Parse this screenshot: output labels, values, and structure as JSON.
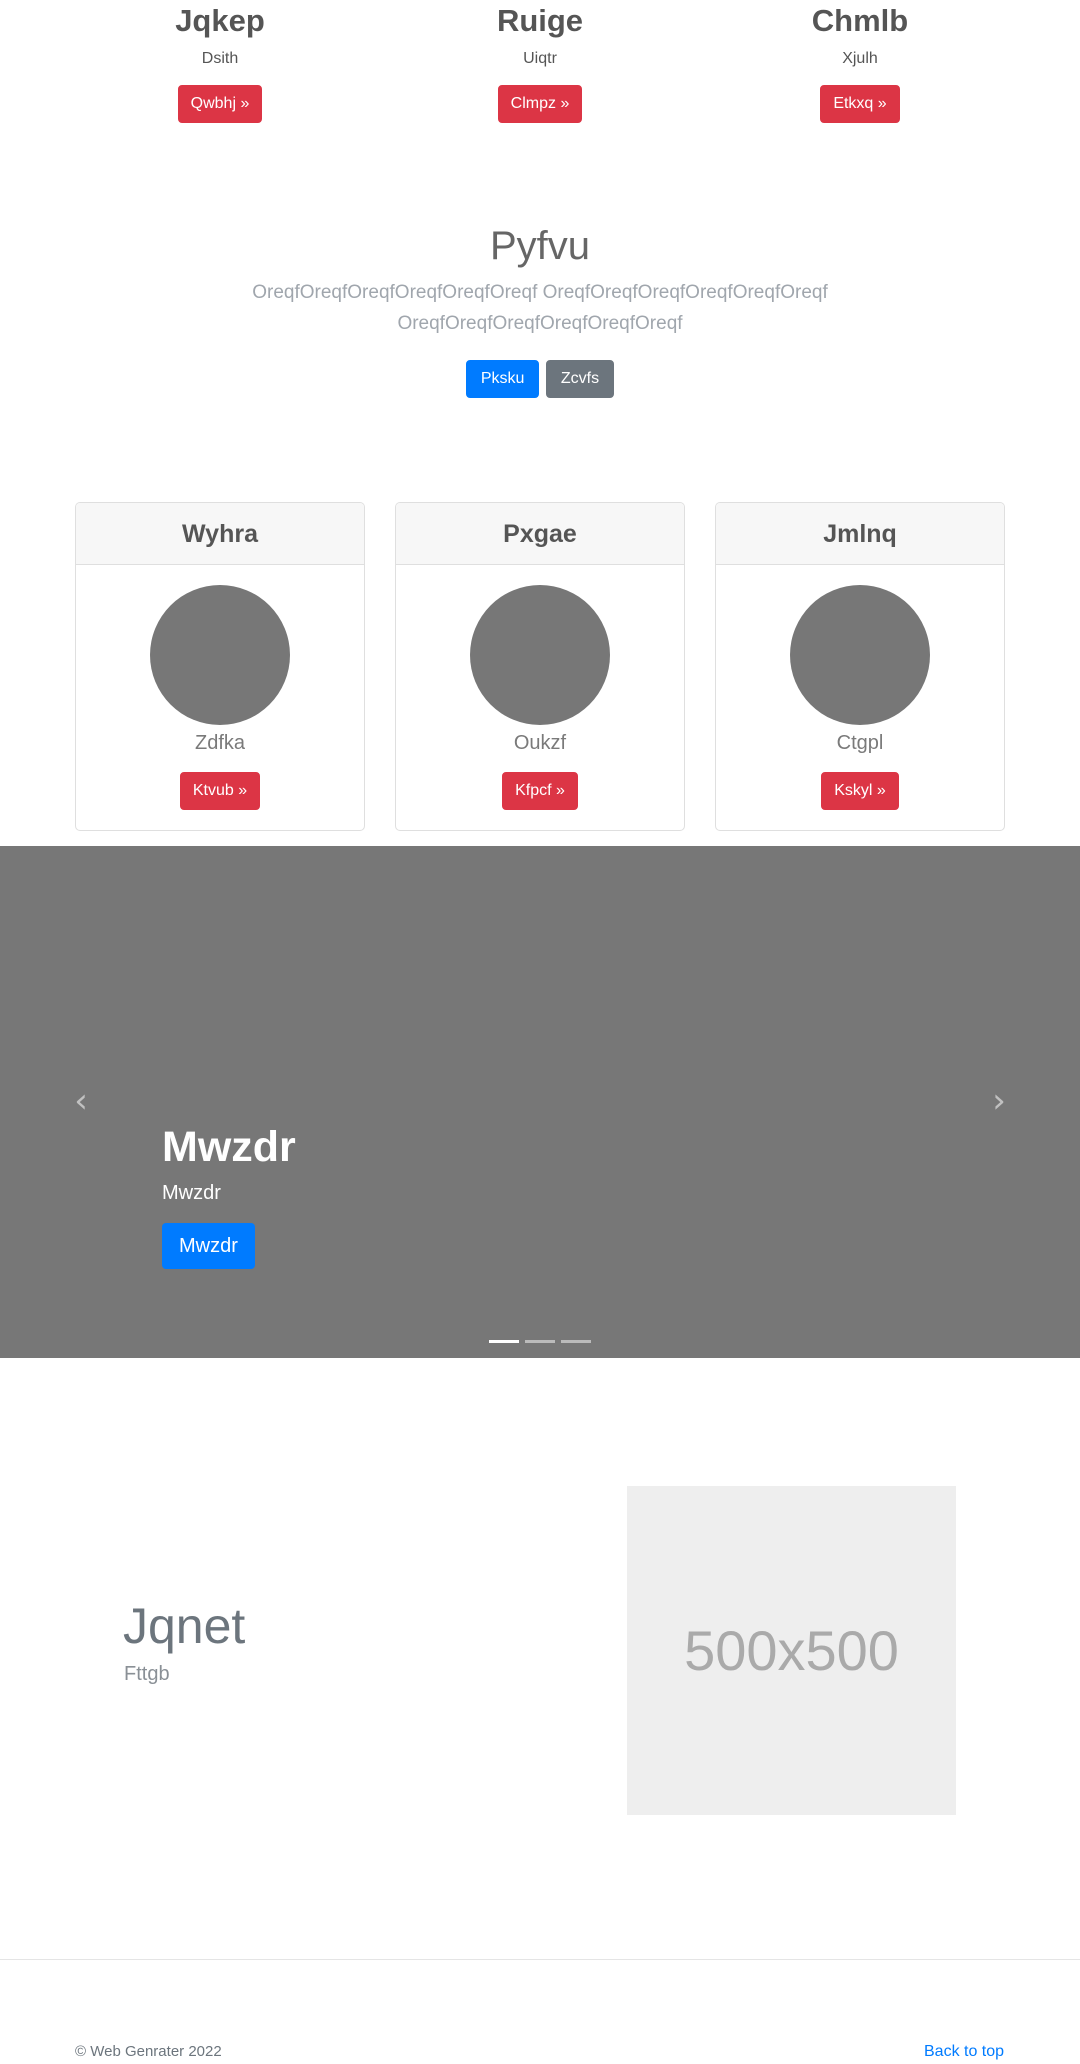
{
  "top_columns": [
    {
      "heading": "Jqkep",
      "sub": "Dsith",
      "button": "Qwbhj »"
    },
    {
      "heading": "Ruige",
      "sub": "Uiqtr",
      "button": "Clmpz »"
    },
    {
      "heading": "Chmlb",
      "sub": "Xjulh",
      "button": "Etkxq »"
    }
  ],
  "hero": {
    "title": "Pyfvu",
    "lead": "OreqfOreqfOreqfOreqfOreqfOreqf OreqfOreqfOreqfOreqfOreqfOreqf OreqfOreqfOreqfOreqfOreqfOreqf",
    "primary_button": "Pksku",
    "secondary_button": "Zcvfs"
  },
  "cards": [
    {
      "header": "Wyhra",
      "name": "Zdfka",
      "button": "Ktvub »"
    },
    {
      "header": "Pxgae",
      "name": "Oukzf",
      "button": "Kfpcf »"
    },
    {
      "header": "Jmlnq",
      "name": "Ctgpl",
      "button": "Kskyl »"
    }
  ],
  "carousel": {
    "title": "Mwzdr",
    "subtitle": "Mwzdr",
    "button": "Mwzdr",
    "prev_icon": "chevron-left-icon",
    "next_icon": "chevron-right-icon",
    "slide_count": 3,
    "active_index": 0
  },
  "feature": {
    "title": "Jqnet",
    "subtitle": "Fttgb",
    "image_placeholder": "500x500"
  },
  "footer": {
    "copyright": "© Web Genrater 2022",
    "back_to_top": "Back to top"
  },
  "colors": {
    "danger": "#dc3545",
    "primary": "#007bff",
    "secondary": "#6c757d",
    "placeholder_gray": "#777777"
  }
}
